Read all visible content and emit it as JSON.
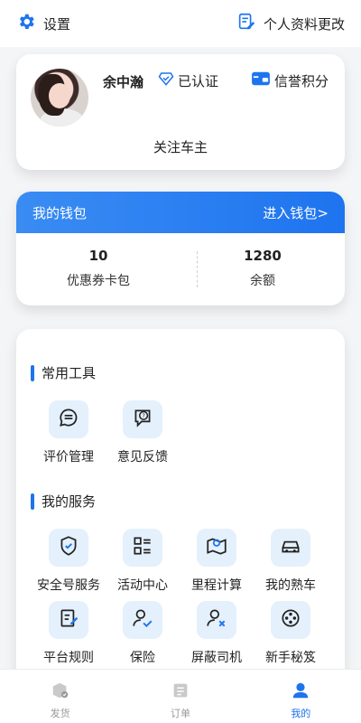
{
  "header": {
    "settings_label": "设置",
    "profile_edit_label": "个人资料更改"
  },
  "user": {
    "name": "余中瀚",
    "verified_label": "已认证",
    "credit_label": "信誉积分",
    "follow_label": "关注车主"
  },
  "wallet": {
    "title": "我的钱包",
    "enter_label": "进入钱包>",
    "stats": [
      {
        "value": "10",
        "label": "优惠券卡包"
      },
      {
        "value": "1280",
        "label": "余额"
      }
    ]
  },
  "common_tools": {
    "title": "常用工具",
    "items": [
      {
        "label": "评价管理",
        "icon": "comment-icon"
      },
      {
        "label": "意见反馈",
        "icon": "feedback-icon"
      }
    ]
  },
  "my_services": {
    "title": "我的服务",
    "items": [
      {
        "label": "安全号服务",
        "icon": "shield-check-icon"
      },
      {
        "label": "活动中心",
        "icon": "list-grid-icon"
      },
      {
        "label": "里程计算",
        "icon": "map-pin-icon"
      },
      {
        "label": "我的熟车",
        "icon": "car-icon"
      },
      {
        "label": "平台规则",
        "icon": "document-edit-icon"
      },
      {
        "label": "保险",
        "icon": "user-check-icon"
      },
      {
        "label": "屏蔽司机",
        "icon": "user-block-icon"
      },
      {
        "label": "新手秘笈",
        "icon": "film-reel-icon"
      }
    ]
  },
  "tabbar": {
    "items": [
      {
        "label": "发货",
        "icon": "box-truck-icon",
        "active": false
      },
      {
        "label": "订单",
        "icon": "order-list-icon",
        "active": false
      },
      {
        "label": "我的",
        "icon": "profile-icon",
        "active": true
      }
    ]
  },
  "colors": {
    "accent": "#1e74ef",
    "icon_bg": "#e4f0fc"
  }
}
